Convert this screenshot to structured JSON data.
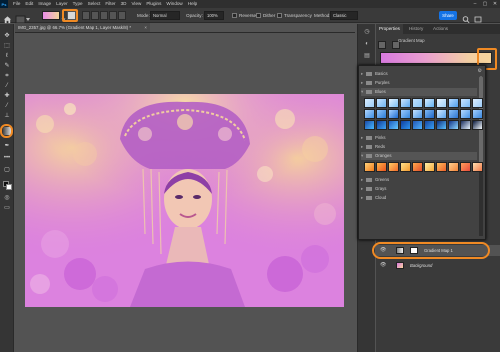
{
  "app": {
    "logo": "Ps"
  },
  "menu": [
    "File",
    "Edit",
    "Image",
    "Layer",
    "Type",
    "Select",
    "Filter",
    "3D",
    "View",
    "Plugins",
    "Window",
    "Help"
  ],
  "window_controls": [
    "–",
    "▢",
    "✕"
  ],
  "options_bar": {
    "mode_label": "Mode:",
    "mode_value": "Normal",
    "opacity_label": "Opacity:",
    "opacity_value": "100%",
    "reverse_label": "Reverse",
    "dither_label": "Dither",
    "transparency_label": "Transparency",
    "method_label": "Method:",
    "method_value": "Classic",
    "share_label": "Share"
  },
  "document": {
    "tab_title": "IMG_2357.jpg @ 66.7% (Gradient Map 1, Layer Mask/8) *",
    "close": "×"
  },
  "properties": {
    "tabs": [
      "Properties",
      "History",
      "Actions"
    ],
    "title": "Gradient Map",
    "gradient_colors": [
      "#d87adf",
      "#f7d49b"
    ]
  },
  "gradient_picker": {
    "folders": [
      {
        "name": "Basics",
        "open": false
      },
      {
        "name": "Purples",
        "open": false
      },
      {
        "name": "Blues",
        "open": true
      },
      {
        "name": "Pinks",
        "open": false
      },
      {
        "name": "Reds",
        "open": false
      },
      {
        "name": "Oranges",
        "open": true
      },
      {
        "name": "Greens",
        "open": false
      },
      {
        "name": "Grays",
        "open": false
      },
      {
        "name": "Cloud",
        "open": false
      }
    ],
    "blues_swatches": [
      [
        "#d9ecff",
        "#9ccdf7"
      ],
      [
        "#c7e3ff",
        "#6fb5f0"
      ],
      [
        "#e6f3ff",
        "#7bbff5"
      ],
      [
        "#cfe6ff",
        "#5aa7ef"
      ],
      [
        "#bfe0ff",
        "#8cc7f7"
      ],
      [
        "#d4ebff",
        "#64b2f2"
      ],
      [
        "#e8f4ff",
        "#a1d2fa"
      ],
      [
        "#b9dcff",
        "#4e9deb"
      ],
      [
        "#cbe5ff",
        "#7ab9f4"
      ],
      [
        "#ddeeff",
        "#9cccf8"
      ],
      [
        "#b0d6ff",
        "#3e8fe3"
      ],
      [
        "#8fc5fb",
        "#2b7bd6"
      ],
      [
        "#a9d2ff",
        "#1e6bd0"
      ],
      [
        "#9ccbff",
        "#3585dd"
      ],
      [
        "#c4e1ff",
        "#4b98e7"
      ],
      [
        "#7fbaf6",
        "#1f66c6"
      ],
      [
        "#d1e8ff",
        "#5aa4ee"
      ],
      [
        "#89c0f8",
        "#2c74d1"
      ],
      [
        "#b8dbff",
        "#4592e5"
      ],
      [
        "#a4d0ff",
        "#3a88df"
      ],
      [
        "#1a4aa8",
        "#48b9ff"
      ],
      [
        "#0f3b96",
        "#3fa4f5"
      ],
      [
        "#1a5bc0",
        "#66c8ff"
      ],
      [
        "#103f9e",
        "#2f95ef"
      ],
      [
        "#2256b5",
        "#4fb2fc"
      ],
      [
        "#17449f",
        "#39a1f3"
      ],
      [
        "#0d2f7e",
        "#5ac0ff"
      ],
      [
        "#11358a",
        "#8fd8ff"
      ],
      [
        "#1b2e5e",
        "#e8f4ff"
      ],
      [
        "#0a1a3e",
        "#f5fbff"
      ]
    ],
    "oranges_swatches": [
      [
        "#ffd27a",
        "#f07a1a"
      ],
      [
        "#ffb347",
        "#e8531f"
      ],
      [
        "#ffcc66",
        "#f06a2a"
      ],
      [
        "#ffe08a",
        "#f29a2e"
      ],
      [
        "#ffa94d",
        "#e24e2a"
      ],
      [
        "#fff0a8",
        "#f6a93a"
      ],
      [
        "#ffbe5c",
        "#eb602a"
      ],
      [
        "#ffd08f",
        "#f2843a"
      ],
      [
        "#ff9e5c",
        "#e84a3a"
      ],
      [
        "#ffe0b0",
        "#f27a4a"
      ]
    ]
  },
  "layers": [
    {
      "name": "Gradient Map 1",
      "selected": true
    },
    {
      "name": "Background",
      "selected": false
    }
  ],
  "icons": {
    "home": "home-icon",
    "eye": "eye-icon",
    "gear": "gear-icon"
  },
  "colors": {
    "highlight": "#f08a24",
    "accent": "#1473e6",
    "photo_magenta": "#d97ade",
    "photo_yellow": "#f7d49b"
  }
}
